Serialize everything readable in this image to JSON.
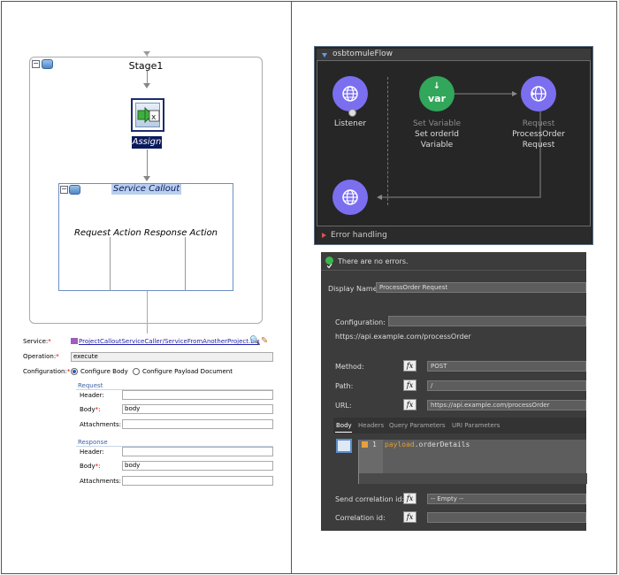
{
  "left": {
    "stage": {
      "title": "Stage1"
    },
    "assign": {
      "label": "Assign"
    },
    "service_callout": {
      "title": "Service Callout",
      "actions": "Request Action Response Action"
    },
    "form": {
      "service_label": "Service:",
      "service_value": "ProjectCalloutServiceCaller/ServiceFromAnotherProject.bix",
      "operation_label": "Operation:",
      "operation_value": "execute",
      "configuration_label": "Configuration:",
      "configure_body": "Configure Body",
      "configure_payload": "Configure Payload Document",
      "request_section": "Request",
      "response_section": "Response",
      "header_label": "Header:",
      "body_label": "Body",
      "attachments_label": "Attachments:",
      "request_body_value": "body",
      "response_body_value": "body",
      "required_mark": "*",
      "colon": ":"
    }
  },
  "right": {
    "flow": {
      "name": "osbtomuleFlow",
      "nodes": {
        "listener": "Listener",
        "set_variable_type": "Set Variable",
        "set_variable_name_1": "Set orderId",
        "set_variable_name_2": "Variable",
        "var_glyph": "var",
        "request_type": "Request",
        "request_name_1": "ProcessOrder",
        "request_name_2": "Request"
      },
      "error_handling": "Error handling"
    },
    "props": {
      "status": "There are no errors.",
      "display_name_label": "Display Name:",
      "display_name_value": "ProcessOrder Request",
      "configuration_label": "Configuration:",
      "configuration_url": "https://api.example.com/processOrder",
      "method_label": "Method:",
      "method_value": "POST",
      "path_label": "Path:",
      "path_value": "/",
      "url_label": "URL:",
      "url_value": "https://api.example.com/processOrder",
      "fx": "fx",
      "tabs": [
        "Body",
        "Headers",
        "Query Parameters",
        "URI Parameters"
      ],
      "line_number": "1",
      "code_keyword": "payload",
      "code_rest": ".orderDetails",
      "send_correlation_label": "Send correlation id:",
      "send_correlation_value": "-- Empty --",
      "correlation_label": "Correlation id:"
    }
  }
}
